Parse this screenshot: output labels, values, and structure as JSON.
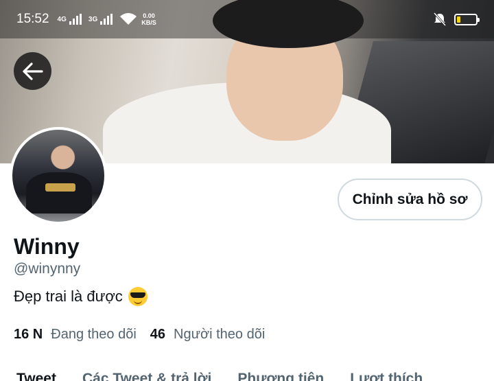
{
  "status_bar": {
    "time": "15:52",
    "signal1": "4G",
    "signal2": "3G",
    "speed_value": "0.00",
    "speed_unit": "KB/S",
    "battery_level": 0.2
  },
  "profile": {
    "display_name": "Winny",
    "handle": "@winynny",
    "bio": "Đẹp trai là được",
    "bio_emoji": "smiling-face-with-sunglasses-icon",
    "edit_label": "Chỉnh sửa hồ sơ",
    "following_count": "16 N",
    "following_label": "Đang theo dõi",
    "followers_count": "46",
    "followers_label": "Người theo dõi"
  },
  "tabs": [
    "Tweet",
    "Các Tweet & trả lời",
    "Phương tiện",
    "Lượt thích"
  ]
}
